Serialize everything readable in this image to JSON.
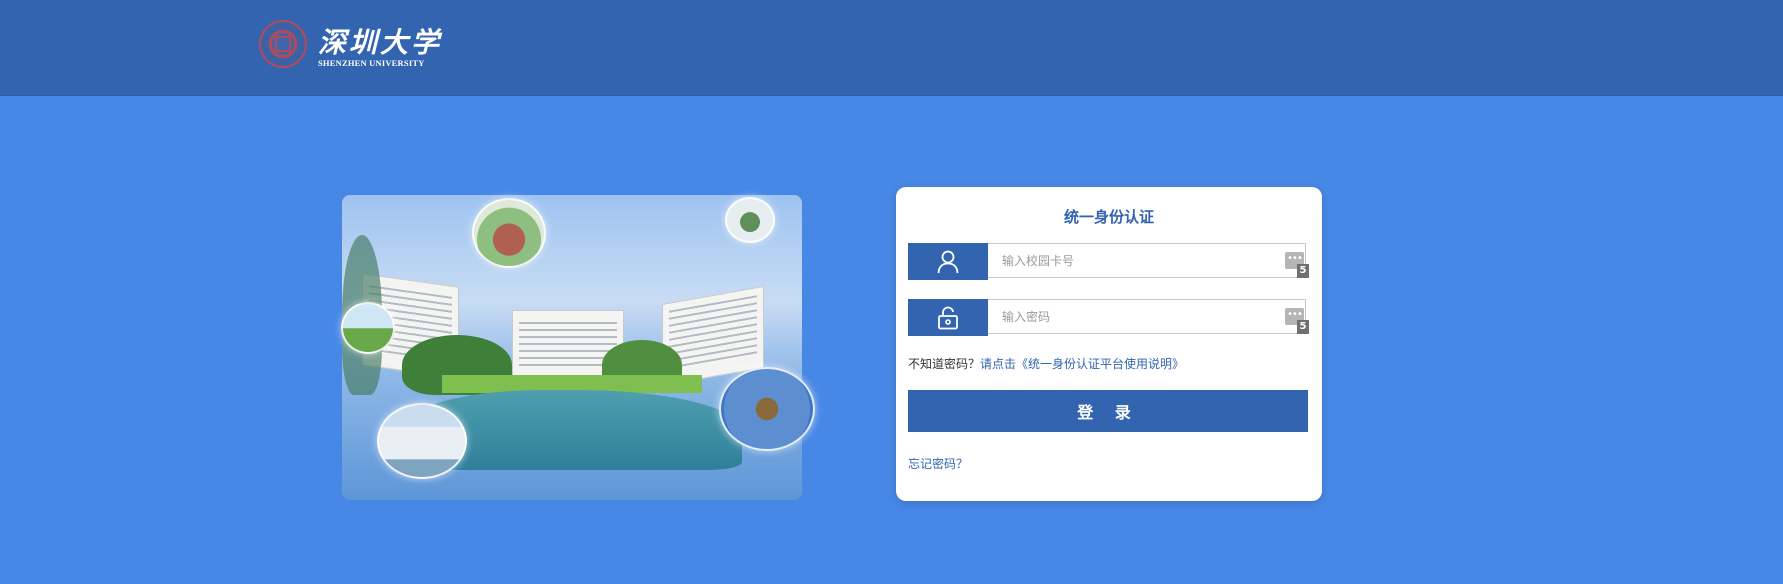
{
  "header": {
    "logo_cn": "深圳大学",
    "logo_en": "SHENZHEN UNIVERSITY"
  },
  "login": {
    "title": "统一身份认证",
    "username_placeholder": "输入校园卡号",
    "password_placeholder": "输入密码",
    "field_badge": "5",
    "field_dots": "•••",
    "hint_prefix": "不知道密码？",
    "hint_link": "请点击《统一身份认证平台使用说明》",
    "login_button": "登 录",
    "forgot_link": "忘记密码？"
  },
  "icons": {
    "user": "user-icon",
    "lock": "unlock-icon"
  },
  "colors": {
    "page_bg": "#4787e6",
    "header_bg": "#3264b0",
    "accent": "#3264b0"
  }
}
